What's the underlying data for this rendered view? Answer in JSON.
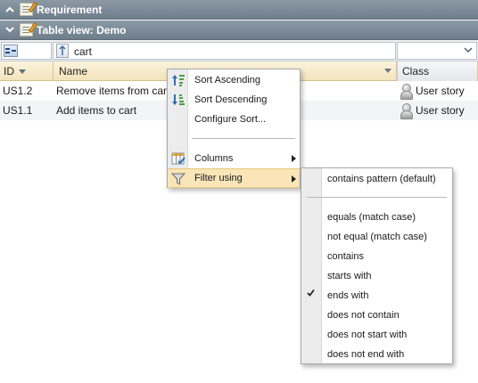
{
  "panels": {
    "requirement": {
      "title": "Requirement"
    },
    "table_view": {
      "title": "Table view: Demo"
    }
  },
  "filter": {
    "name_value": "cart"
  },
  "columns": {
    "id": "ID",
    "name": "Name",
    "class": "Class"
  },
  "rows": [
    {
      "id": "US1.2",
      "name": "Remove items from cart",
      "class": "User story"
    },
    {
      "id": "US1.1",
      "name": "Add items to cart",
      "class": "User story"
    }
  ],
  "context_menu": {
    "items": [
      {
        "label": "Sort Ascending",
        "icon": "sort-ascending-icon"
      },
      {
        "label": "Sort Descending",
        "icon": "sort-descending-icon"
      },
      {
        "label": "Configure Sort..."
      },
      {
        "label": "Columns",
        "icon": "columns-icon",
        "submenu": true
      },
      {
        "label": "Filter using",
        "icon": "funnel-icon",
        "submenu": true,
        "highlighted": true
      }
    ]
  },
  "filter_submenu": {
    "items": [
      {
        "label": "contains pattern (default)"
      },
      {
        "label": "equals (match case)"
      },
      {
        "label": "not equal (match case)"
      },
      {
        "label": "contains"
      },
      {
        "label": "starts with"
      },
      {
        "label": "ends with",
        "checked": true
      },
      {
        "label": "does not contain"
      },
      {
        "label": "does not start with"
      },
      {
        "label": "does not end with"
      }
    ]
  },
  "colors": {
    "header_bar": "#7c8a97",
    "column_header": "#f6e9c6",
    "menu_highlight": "#f9e5b7"
  }
}
